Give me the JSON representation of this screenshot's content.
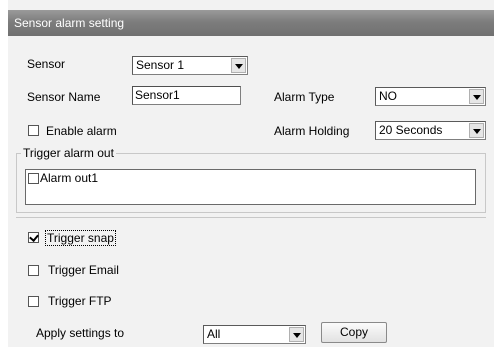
{
  "title": "Sensor alarm setting",
  "sensor": {
    "label": "Sensor",
    "value": "Sensor 1"
  },
  "sensor_name": {
    "label": "Sensor Name",
    "value": "Sensor1"
  },
  "alarm_type": {
    "label": "Alarm Type",
    "value": "NO"
  },
  "enable_alarm": {
    "label": "Enable alarm",
    "checked": false
  },
  "alarm_holding": {
    "label": "Alarm Holding",
    "value": "20 Seconds"
  },
  "trigger_alarm_out": {
    "label": "Trigger alarm out",
    "items": [
      {
        "label": "Alarm out1",
        "checked": false
      }
    ]
  },
  "trigger_snap": {
    "label": "Trigger snap",
    "checked": true
  },
  "trigger_email": {
    "label": "Trigger Email",
    "checked": false
  },
  "trigger_ftp": {
    "label": "Trigger FTP",
    "checked": false
  },
  "apply_settings": {
    "label": "Apply settings to",
    "value": "All"
  },
  "copy_button": {
    "label": "Copy"
  }
}
